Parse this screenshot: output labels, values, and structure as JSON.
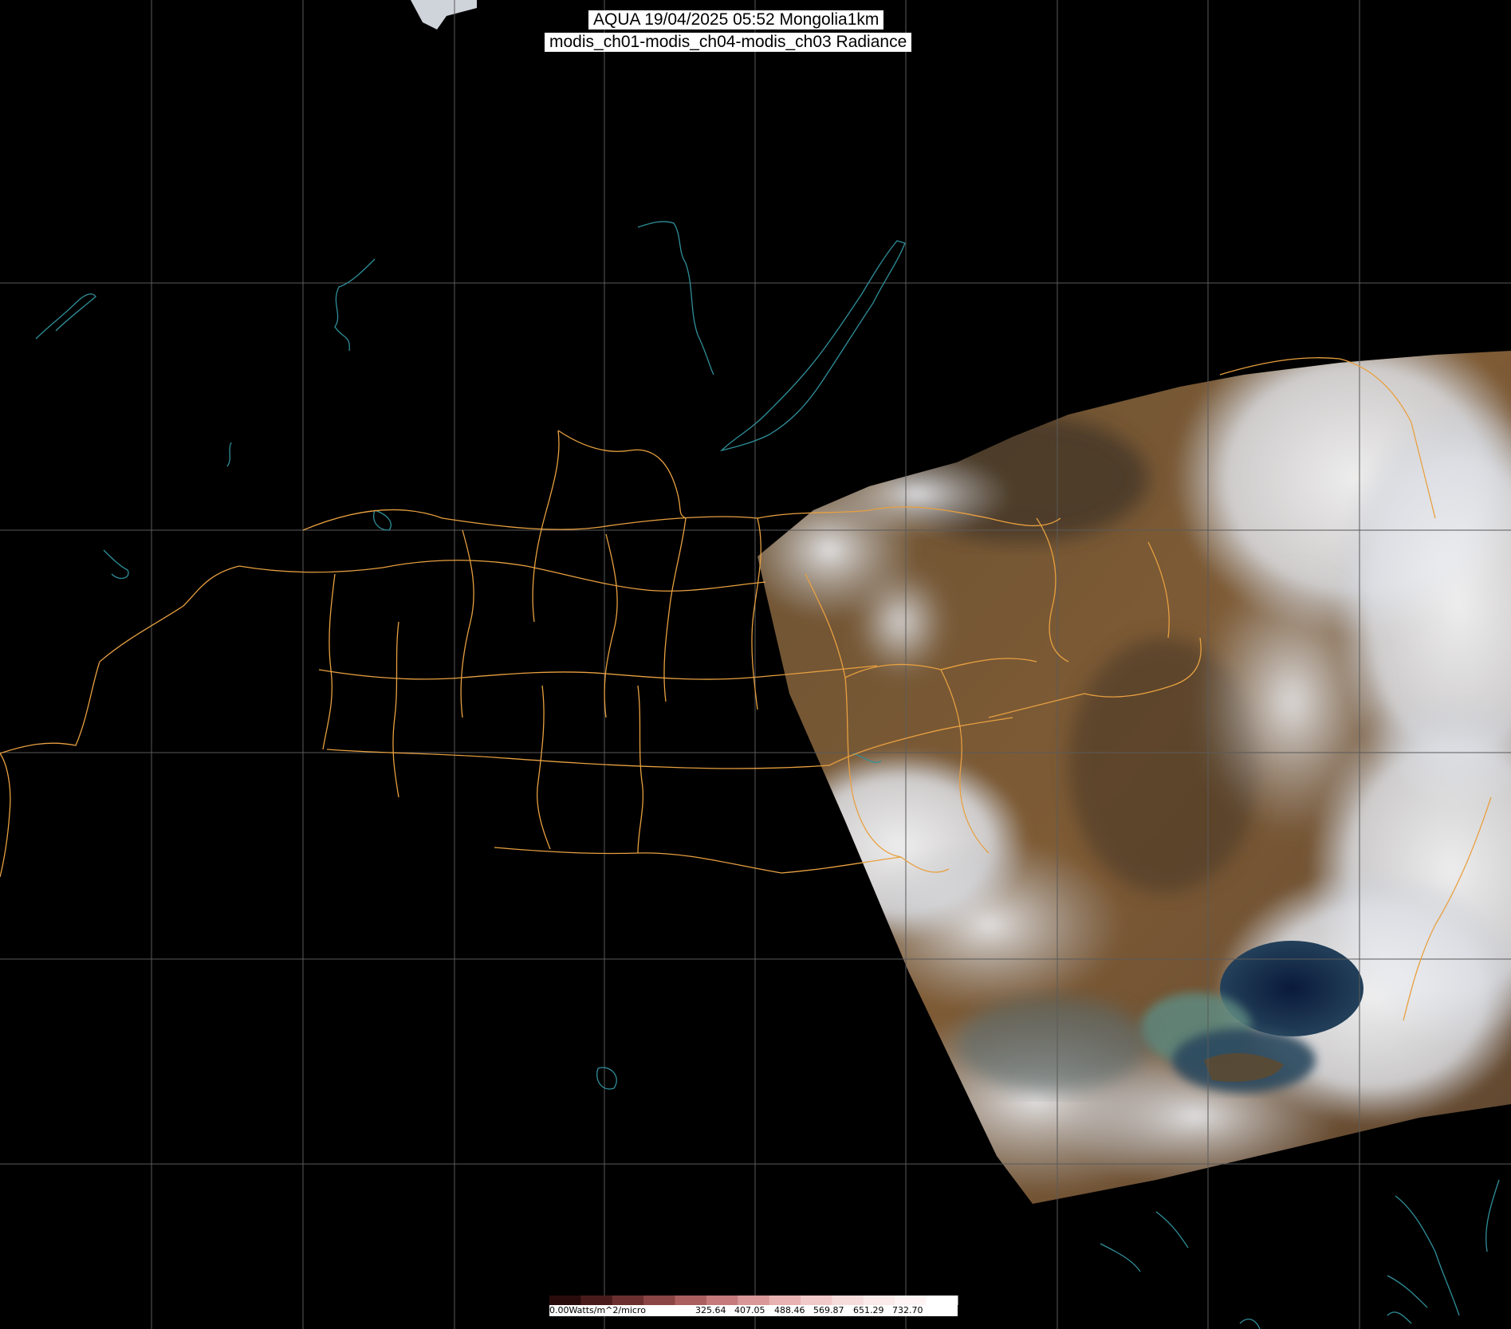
{
  "title": {
    "line1": "AQUA 19/04/2025 05:52 Mongolia1km",
    "line2": "modis_ch01-modis_ch04-modis_ch03 Radiance"
  },
  "colorbar": {
    "unit_label": "0.00Watts/m^2/micro",
    "tick_labels": [
      "325.64",
      "407.05",
      "488.46",
      "569.87",
      "651.29",
      "732.70"
    ],
    "colors": [
      "#2a0b0b",
      "#4a1b1b",
      "#6b2f2f",
      "#8c4545",
      "#ab5f5f",
      "#c57b7b",
      "#d99797",
      "#e8b2b2",
      "#f2c9c9",
      "#f7dcdc",
      "#fbeaea",
      "#fef4f4",
      "#ffffff"
    ]
  },
  "colors": {
    "background": "#000000",
    "grid": "#5a5a5a",
    "borders": "#e8a040",
    "coast": "#2f8f9a",
    "land": "#7a5a36",
    "cloud": "#e6e8ec",
    "sea": "#0f2144"
  }
}
